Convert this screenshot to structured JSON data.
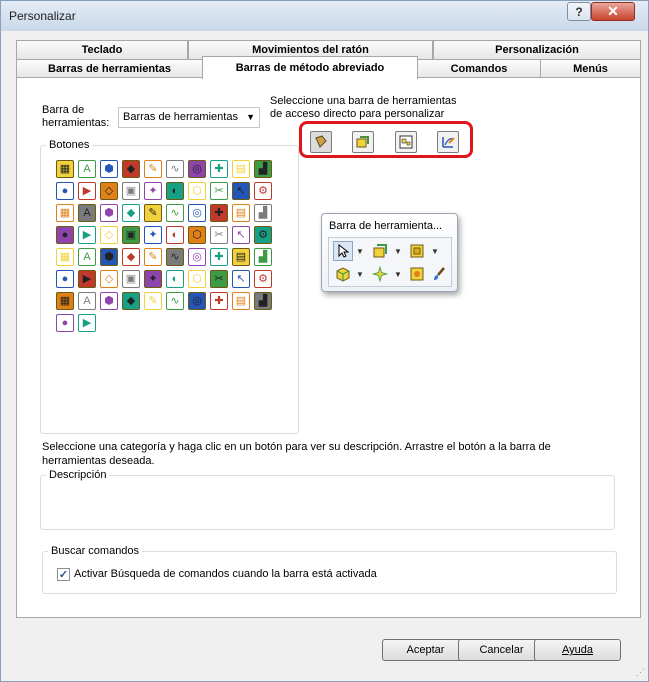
{
  "window": {
    "title": "Personalizar",
    "help_glyph": "?",
    "close_glyph": "✕"
  },
  "tabs": {
    "row1": [
      "Teclado",
      "Movimientos del ratón",
      "Personalización"
    ],
    "row2": [
      "Barras de herramientas",
      "Barras de método abreviado",
      "Comandos",
      "Menús"
    ],
    "active": "Barras de método abreviado"
  },
  "toolbar_select": {
    "label_line1": "Barra de",
    "label_line2": "herramientas:",
    "value": "Barras de herramientas"
  },
  "quick_access": {
    "instruction_line1": "Seleccione una barra de herramientas",
    "instruction_line2": "de acceso directo para personalizar",
    "icons": [
      "part-shortcut-icon",
      "assembly-shortcut-icon",
      "drawing-shortcut-icon",
      "sketch-shortcut-icon"
    ]
  },
  "buttons_group": {
    "title": "Botones",
    "icons": [
      [
        "grid-icon",
        "text-format-icon",
        "letter-a-icon",
        "box-icon",
        "note-a-icon",
        "spline-icon",
        "gauge-icon",
        "crosshair-icon",
        "hatch-icon",
        "stairs-icon"
      ],
      [
        "sphere-icon",
        "bold-italic-icon",
        "plane-icon",
        "lines-icon",
        "bars-icon",
        "extrude-icon",
        "target-icon",
        "sparkle-icon",
        "pie-icon",
        "scissors-icon"
      ],
      [
        "pointer-icon",
        "gear-icon",
        "ruler-icon",
        "sw-logo-icon",
        "bend-icon",
        "stack-icon",
        "copy-box-icon",
        "pencil-icon",
        "table-icon",
        "sum-icon"
      ],
      [
        "cube-icon",
        "globe-icon",
        "axis-icon",
        "lines2-icon",
        "document-icon",
        "folder-icon",
        "save-icon",
        "print-icon",
        "checklist-icon",
        "edit-icon"
      ],
      [
        "line-icon",
        "rectangle-icon",
        "circle-icon",
        "arc-icon",
        "slot-icon",
        "spline2-icon",
        "plus-arc-icon",
        "point-icon",
        "trim-icon",
        "mirror-icon"
      ],
      [
        "dotted-box-icon",
        "dots-grid-icon",
        "measure-icon",
        "arrow-icon",
        "component-icon",
        "block-icon",
        "cylinder-icon",
        "bars2-icon",
        "cone-icon",
        "explode-icon"
      ],
      [
        "split-icon",
        "camera-icon",
        "magnet-icon",
        "rotate-icon",
        "helix-icon",
        "wave-icon",
        "zigzag-icon",
        "tool-icon",
        "key-icon",
        "swap-icon"
      ],
      [
        "cube-blue-icon",
        "settings-icon"
      ]
    ]
  },
  "floating_toolbar": {
    "title": "Barra de herramienta...",
    "icons": [
      "select-arrow-icon",
      "box-green-icon",
      "box-yellow-icon",
      "cube-yellow-icon",
      "sparkle-tool-icon",
      "gear-yellow-icon",
      "brush-icon"
    ]
  },
  "description": {
    "instruction": "Seleccione una categoría y haga clic en un botón para ver su descripción. Arrastre el botón a la barra de herramientas deseada.",
    "title": "Descripción"
  },
  "search": {
    "title": "Buscar comandos",
    "checkbox_label": "Activar Búsqueda de comandos cuando la barra está activada",
    "checked": true,
    "check_glyph": "✓"
  },
  "footer": {
    "accept": "Aceptar",
    "cancel": "Cancelar",
    "help": "Ayuda"
  },
  "colors": {
    "highlight_border": "#e0141d",
    "close_button": "#c9432e"
  }
}
